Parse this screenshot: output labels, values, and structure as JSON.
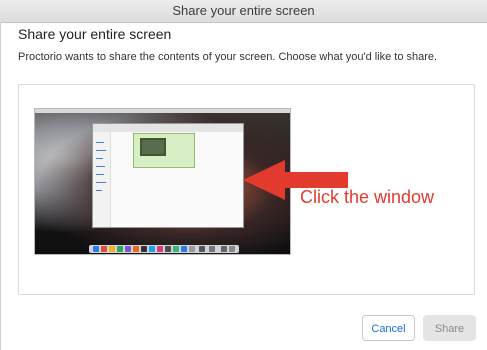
{
  "window": {
    "title": "Share your entire screen"
  },
  "dialog": {
    "heading": "Share your entire screen",
    "subtitle": "Proctorio wants to share the contents of your screen. Choose what you'd like to share."
  },
  "annotation": {
    "text": "Click the window",
    "color": "#e33a2e"
  },
  "buttons": {
    "cancel": "Cancel",
    "share": "Share"
  },
  "colors": {
    "accent": "#1a6fd6",
    "disabled": "#e4e4e4"
  }
}
